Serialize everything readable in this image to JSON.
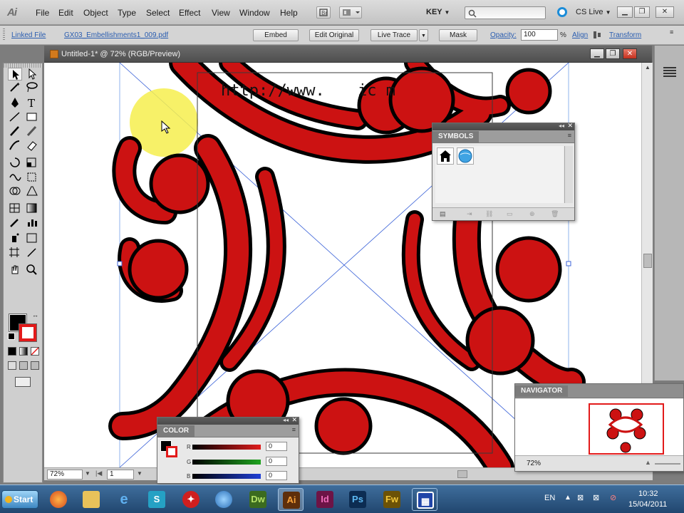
{
  "app": {
    "logo": "Ai"
  },
  "menu": [
    "File",
    "Edit",
    "Object",
    "Type",
    "Select",
    "Effect",
    "View",
    "Window",
    "Help"
  ],
  "menubar_right": {
    "workspace": "KEY",
    "cs_live": "CS Live"
  },
  "controlbar": {
    "linked_file": "Linked File",
    "file_name": "GX03_Embellishments1_009.pdf",
    "embed": "Embed",
    "edit_original": "Edit Original",
    "live_trace": "Live Trace",
    "mask": "Mask",
    "opacity_label": "Opacity:",
    "opacity_value": "100",
    "opacity_unit": "%",
    "align": "Align",
    "transform": "Transform"
  },
  "document": {
    "title": "Untitled-1* @ 72% (RGB/Preview)"
  },
  "canvas": {
    "watermark_text": "http://www.",
    "watermark_tail": "ic    m"
  },
  "symbols_panel": {
    "title": "SYMBOLS",
    "symbols": [
      "house-icon",
      "globe-icon"
    ]
  },
  "color_panel": {
    "title": "COLOR",
    "channels": [
      {
        "label": "R",
        "value": "0",
        "color": "#e01d1d"
      },
      {
        "label": "G",
        "value": "0",
        "color": "#1fa31f"
      },
      {
        "label": "B",
        "value": "0",
        "color": "#1f3fd6"
      }
    ]
  },
  "navigator_panel": {
    "title": "NAVIGATOR",
    "zoom": "72%"
  },
  "statusbar": {
    "zoom": "72%",
    "page": "1"
  },
  "taskbar": {
    "start": "Start",
    "apps": [
      "Firefox",
      "Explorer",
      "Internet Explorer",
      "Flash Catalyst",
      "Acrobat",
      "Messenger",
      "Dw",
      "Ai",
      "Id",
      "Ps",
      "Fw",
      "Manager"
    ],
    "language": "EN",
    "time": "10:32",
    "date": "15/04/2011"
  },
  "colors": {
    "art_red": "#cc1212",
    "art_stroke": "#000000",
    "accent_blue": "#2a5db0"
  }
}
